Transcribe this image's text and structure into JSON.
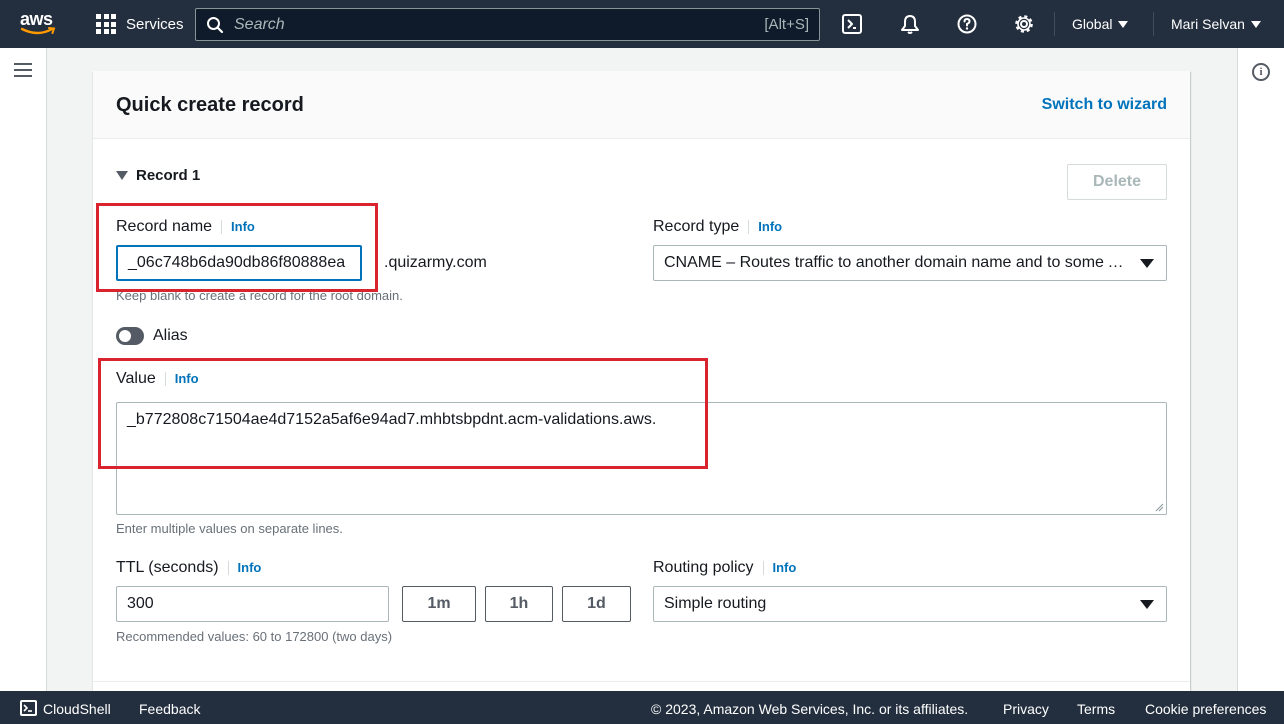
{
  "nav": {
    "logo_text": "aws",
    "services_label": "Services",
    "search_placeholder": "Search",
    "search_shortcut": "[Alt+S]",
    "region": "Global",
    "user": "Mari Selvan"
  },
  "card": {
    "title": "Quick create record",
    "switch_link": "Switch to wizard",
    "record_heading": "Record 1",
    "delete_label": "Delete",
    "info_label": "Info",
    "record_name": {
      "label": "Record name",
      "value": "_06c748b6da90db86f80888ea",
      "suffix": ".quizarmy.com",
      "hint": "Keep blank to create a record for the root domain."
    },
    "record_type": {
      "label": "Record type",
      "selected": "CNAME – Routes traffic to another domain name and to some AWS resources"
    },
    "alias": {
      "label": "Alias",
      "enabled": false
    },
    "value": {
      "label": "Value",
      "text": "_b772808c71504ae4d7152a5af6e94ad7.mhbtsbpdnt.acm-validations.aws.",
      "hint": "Enter multiple values on separate lines."
    },
    "ttl": {
      "label": "TTL (seconds)",
      "value": "300",
      "buttons": [
        "1m",
        "1h",
        "1d"
      ],
      "hint": "Recommended values: 60 to 172800 (two days)"
    },
    "routing": {
      "label": "Routing policy",
      "selected": "Simple routing"
    }
  },
  "footer": {
    "cloudshell": "CloudShell",
    "feedback": "Feedback",
    "copyright": "© 2023, Amazon Web Services, Inc. or its affiliates.",
    "privacy": "Privacy",
    "terms": "Terms",
    "cookies": "Cookie preferences"
  },
  "colors": {
    "nav_bg": "#232f3e",
    "link": "#0073bb",
    "highlight": "#d9232e",
    "focus": "#0073bb"
  }
}
